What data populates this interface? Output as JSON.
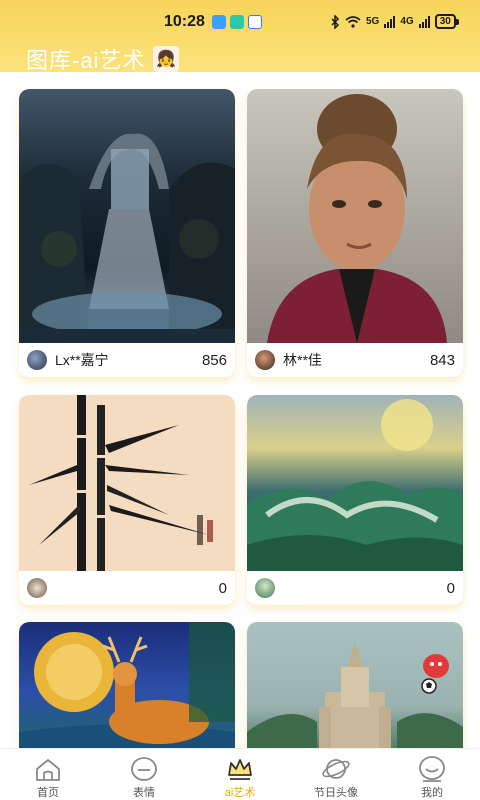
{
  "status": {
    "time": "10:28",
    "network_5g": "5G",
    "network_4g": "4G",
    "battery": "30"
  },
  "header": {
    "title": "图库-ai艺术"
  },
  "cards": [
    {
      "author": "Lx**嘉宁",
      "count": "856",
      "image": "waterfall-painting"
    },
    {
      "author": "林**佳",
      "count": "843",
      "image": "woman-portrait"
    },
    {
      "author": "",
      "count": "0",
      "image": "bamboo-ink-painting"
    },
    {
      "author": "",
      "count": "0",
      "image": "ocean-waves-painting"
    },
    {
      "author": "",
      "count": "",
      "image": "deer-moon-painting"
    },
    {
      "author": "",
      "count": "",
      "image": "castle-painting"
    }
  ],
  "tabs": [
    {
      "label": "首页",
      "icon": "home-icon",
      "active": false
    },
    {
      "label": "表情",
      "icon": "emoji-icon",
      "active": false
    },
    {
      "label": "ai艺术",
      "icon": "crown-icon",
      "active": true
    },
    {
      "label": "节日头像",
      "icon": "planet-icon",
      "active": false
    },
    {
      "label": "我的",
      "icon": "profile-icon",
      "active": false
    }
  ],
  "colors": {
    "header": "#f8d55a",
    "active_tab": "#e7a800"
  }
}
